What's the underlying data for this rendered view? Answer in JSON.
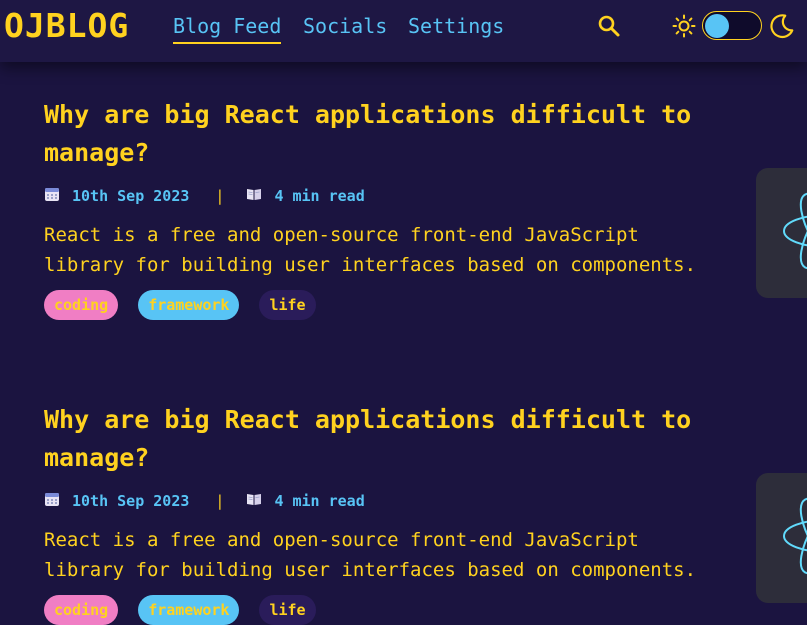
{
  "brand": {
    "logo_text": "OJBLOG"
  },
  "nav": {
    "links": [
      {
        "label": "Blog Feed",
        "active": true
      },
      {
        "label": "Socials",
        "active": false
      },
      {
        "label": "Settings",
        "active": false
      }
    ],
    "icons": {
      "search": "search-icon",
      "light": "sun-icon",
      "dark": "moon-icon"
    },
    "theme_toggle": {
      "state": "light"
    }
  },
  "colors": {
    "background": "#1b1440",
    "nav_background": "#1e1744",
    "accent_yellow": "#ffd21f",
    "accent_blue": "#58c4f5",
    "tag_coding": "#f07ec4",
    "tag_framework": "#58c4f5",
    "tag_life": "#2a1c5a"
  },
  "posts": [
    {
      "title": "Why are big React applications difficult to manage?",
      "date": "10th Sep 2023",
      "separator": "|",
      "read_time": "4 min read",
      "excerpt": "React is a free and open-source front-end JavaScript library for building user interfaces based on components.",
      "tags": [
        "coding",
        "framework",
        "life"
      ]
    },
    {
      "title": "Why are big React applications difficult to manage?",
      "date": "10th Sep 2023",
      "separator": "|",
      "read_time": "4 min read",
      "excerpt": "React is a free and open-source front-end JavaScript library for building user interfaces based on components.",
      "tags": [
        "coding",
        "framework",
        "life"
      ]
    }
  ]
}
